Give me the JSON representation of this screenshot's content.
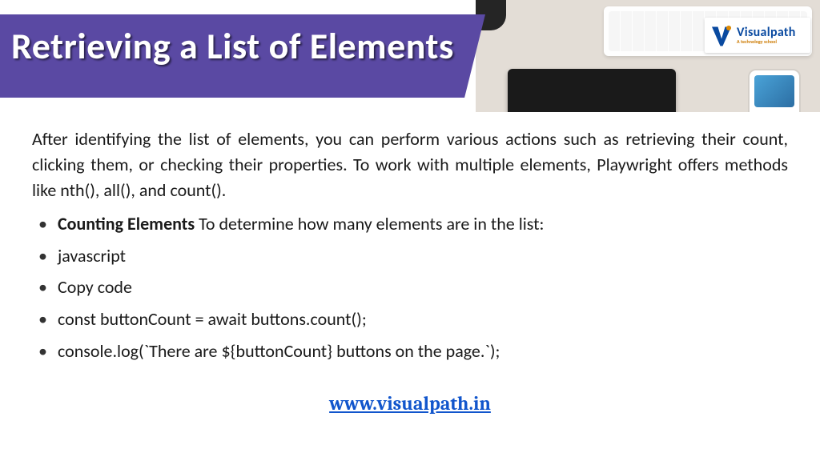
{
  "title": "Retrieving a List of Elements",
  "logo": {
    "name": "Visualpath",
    "tagline": "A technology school"
  },
  "intro": "After identifying the list of elements, you can perform various actions such as retrieving their count, clicking them, or checking their properties. To work with multiple elements, Playwright offers methods like nth(), all(), and count().",
  "bullets": [
    {
      "lead": "Counting Elements",
      "rest": " To determine how many elements are in the list:"
    },
    {
      "lead": "",
      "rest": "javascript"
    },
    {
      "lead": "",
      "rest": "Copy code"
    },
    {
      "lead": "",
      "rest": "const buttonCount = await buttons.count();"
    },
    {
      "lead": "",
      "rest": "console.log(`There are ${buttonCount} buttons on the page.`);"
    }
  ],
  "footer_url": "www.visualpath.in"
}
